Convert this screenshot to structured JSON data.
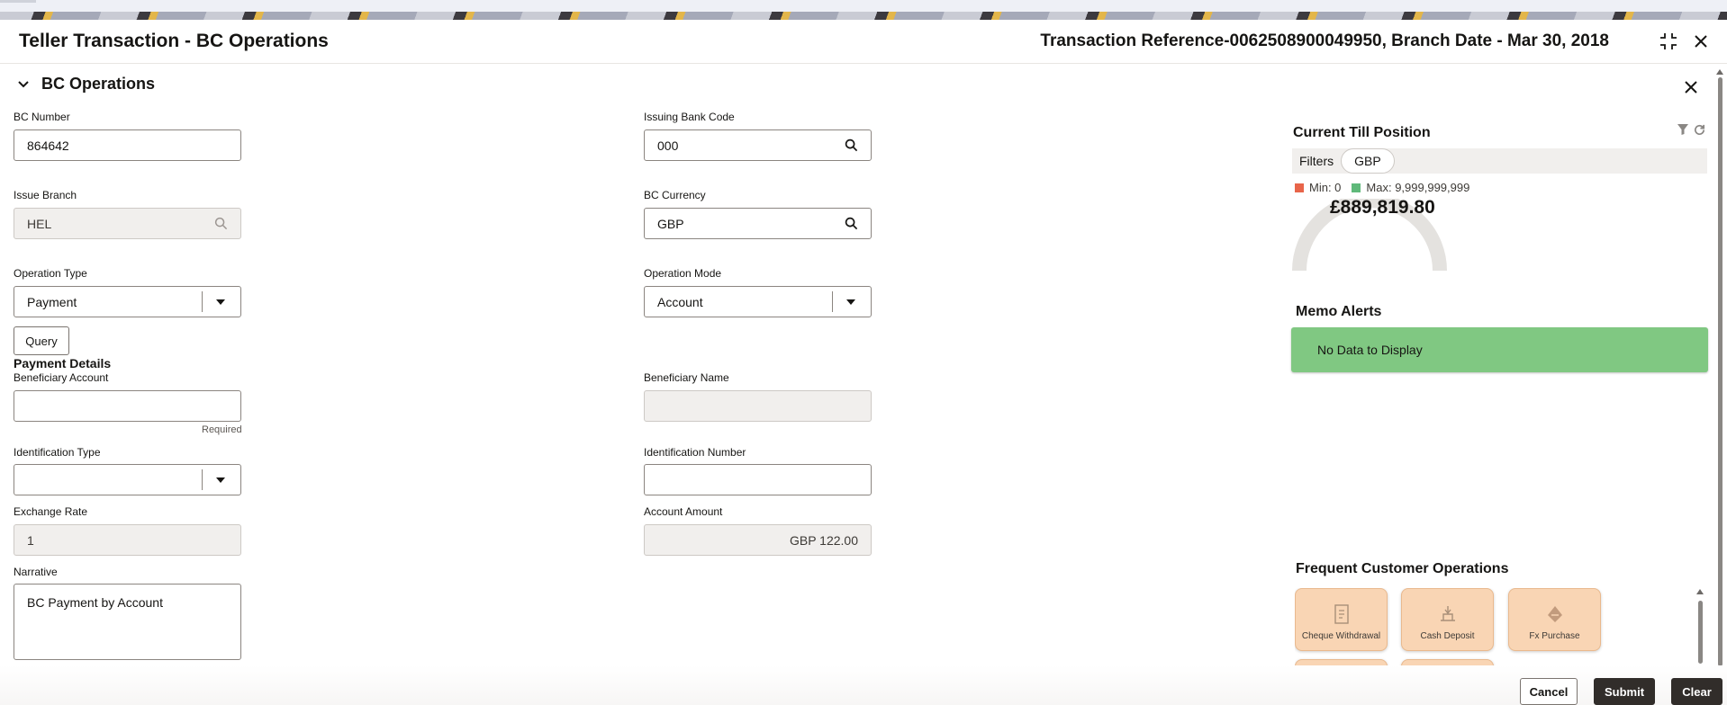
{
  "header": {
    "title": "Teller Transaction - BC Operations",
    "transaction_reference": "Transaction Reference-0062508900049950, Branch Date - Mar 30, 2018"
  },
  "section": {
    "title": "BC Operations"
  },
  "form": {
    "bc_number": {
      "label": "BC Number",
      "value": "864642"
    },
    "issuing_bank_code": {
      "label": "Issuing Bank Code",
      "value": "000"
    },
    "issue_branch": {
      "label": "Issue Branch",
      "value": "HEL"
    },
    "bc_currency": {
      "label": "BC Currency",
      "value": "GBP"
    },
    "operation_type": {
      "label": "Operation Type",
      "value": "Payment"
    },
    "operation_mode": {
      "label": "Operation Mode",
      "value": "Account"
    },
    "query_label": "Query",
    "payment_details_title": "Payment Details",
    "beneficiary_account": {
      "label": "Beneficiary Account",
      "value": "",
      "hint": "Required"
    },
    "beneficiary_name": {
      "label": "Beneficiary Name",
      "value": ""
    },
    "identification_type": {
      "label": "Identification Type",
      "value": ""
    },
    "identification_number": {
      "label": "Identification Number",
      "value": ""
    },
    "exchange_rate": {
      "label": "Exchange Rate",
      "value": "1"
    },
    "account_amount": {
      "label": "Account Amount",
      "value": "GBP 122.00"
    },
    "narrative": {
      "label": "Narrative",
      "value": "BC Payment by Account"
    }
  },
  "till": {
    "title": "Current Till Position",
    "filters_label": "Filters",
    "filter_chip": "GBP",
    "min_label": "Min: 0",
    "max_label": "Max: 9,999,999,999",
    "amount": "£889,819.80",
    "min_color": "#e8654a",
    "max_color": "#5fb97a"
  },
  "memo": {
    "title": "Memo Alerts",
    "message": "No Data to Display"
  },
  "fco": {
    "title": "Frequent Customer Operations",
    "items": [
      {
        "label": "Cheque Withdrawal",
        "icon": "cheque-icon"
      },
      {
        "label": "Cash Deposit",
        "icon": "cash-deposit-icon"
      },
      {
        "label": "Fx Purchase",
        "icon": "fx-purchase-icon"
      },
      {
        "label": "",
        "icon": "operation-icon"
      },
      {
        "label": "",
        "icon": "operation-icon"
      }
    ]
  },
  "footer": {
    "cancel": "Cancel",
    "submit": "Submit",
    "clear": "Clear"
  },
  "colors": {
    "accent": "#312d2a",
    "memo_bg": "#80c882",
    "card_bg": "#f9d5b4"
  }
}
